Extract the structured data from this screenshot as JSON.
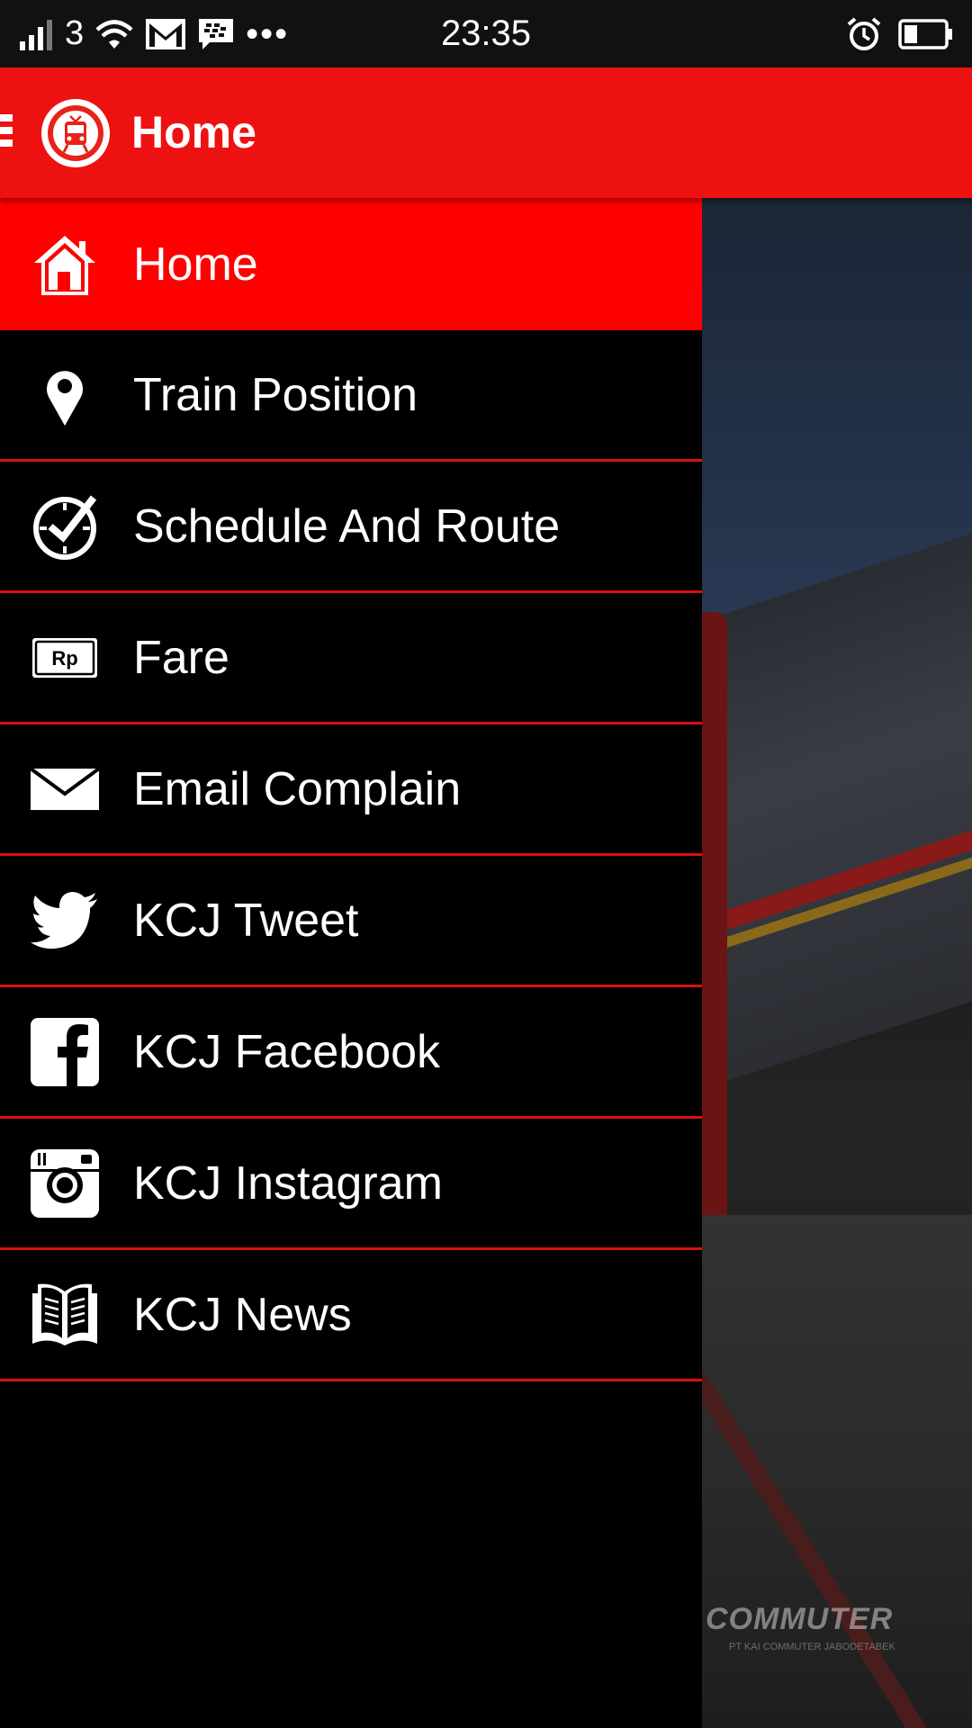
{
  "status_bar": {
    "carrier": "3",
    "time": "23:35",
    "icons": [
      "signal-icon",
      "wifi-icon",
      "gmail-icon",
      "bbm-icon",
      "more-icon",
      "alarm-icon",
      "battery-icon"
    ]
  },
  "app_bar": {
    "title": "Home",
    "icons": [
      "hamburger-icon",
      "app-logo-icon"
    ]
  },
  "drawer": {
    "items": [
      {
        "label": "Home",
        "icon": "home-icon",
        "active": true
      },
      {
        "label": "Train Position",
        "icon": "location-pin-icon",
        "active": false
      },
      {
        "label": "Schedule And Route",
        "icon": "clock-check-icon",
        "active": false
      },
      {
        "label": "Fare",
        "icon": "rupiah-icon",
        "active": false
      },
      {
        "label": "Email Complain",
        "icon": "envelope-icon",
        "active": false
      },
      {
        "label": "KCJ Tweet",
        "icon": "twitter-icon",
        "active": false
      },
      {
        "label": "KCJ Facebook",
        "icon": "facebook-icon",
        "active": false
      },
      {
        "label": "KCJ Instagram",
        "icon": "instagram-icon",
        "active": false
      },
      {
        "label": "KCJ News",
        "icon": "book-icon",
        "active": false
      }
    ]
  },
  "background": {
    "watermark": "COMMUTER",
    "watermark_sub": "PT KAI COMMUTER JABODETABEK"
  },
  "colors": {
    "app_bar": "#ee1111",
    "active_item": "#ff0000",
    "divider": "#d8110b",
    "drawer_bg": "#000000",
    "status_bar": "#111111"
  }
}
